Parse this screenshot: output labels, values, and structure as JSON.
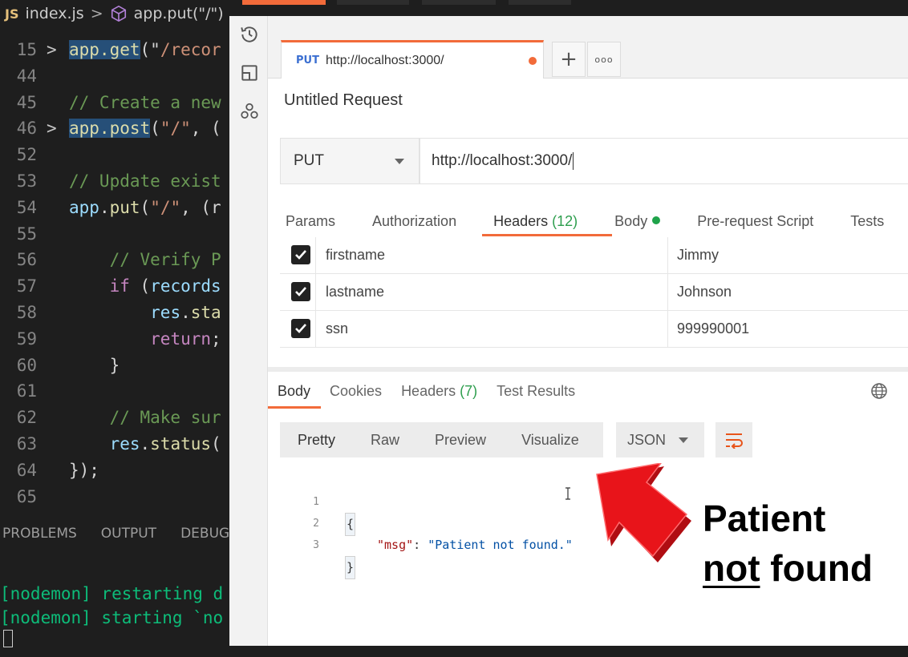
{
  "editor": {
    "breadcrumb": {
      "lang_badge": "JS",
      "file": "index.js",
      "sep": ">",
      "symbol": "app.put(\"/\")"
    },
    "lines": [
      {
        "n": "15",
        "fold": ">",
        "segments": [
          [
            "fn",
            "app.get"
          ],
          [
            "punc",
            "(\""
          ],
          [
            "str",
            "/recor"
          ]
        ]
      },
      {
        "n": "44",
        "fold": "",
        "segments": []
      },
      {
        "n": "45",
        "fold": "",
        "segments": [
          [
            "com",
            "// Create a new"
          ]
        ]
      },
      {
        "n": "46",
        "fold": ">",
        "segments": [
          [
            "fn",
            "app.post"
          ],
          [
            "punc",
            "("
          ],
          [
            "str",
            "\"/\""
          ],
          [
            "punc",
            ", ("
          ]
        ]
      },
      {
        "n": "52",
        "fold": "",
        "segments": []
      },
      {
        "n": "53",
        "fold": "",
        "segments": [
          [
            "com",
            "// Update exist"
          ]
        ]
      },
      {
        "n": "54",
        "fold": "",
        "segments": [
          [
            "obj",
            "app"
          ],
          [
            "punc",
            "."
          ],
          [
            "fnp",
            "put"
          ],
          [
            "punc",
            "("
          ],
          [
            "str",
            "\"/\""
          ],
          [
            "punc",
            ", (r"
          ]
        ]
      },
      {
        "n": "55",
        "fold": "",
        "segments": []
      },
      {
        "n": "56",
        "fold": "",
        "segments": [
          [
            "sp",
            "    "
          ],
          [
            "com",
            "// Verify P"
          ]
        ]
      },
      {
        "n": "57",
        "fold": "",
        "segments": [
          [
            "sp",
            "    "
          ],
          [
            "kw",
            "if"
          ],
          [
            "punc",
            " ("
          ],
          [
            "obj",
            "records"
          ]
        ]
      },
      {
        "n": "58",
        "fold": "",
        "segments": [
          [
            "sp",
            "        "
          ],
          [
            "obj",
            "res"
          ],
          [
            "punc",
            "."
          ],
          [
            "fnp",
            "sta"
          ]
        ]
      },
      {
        "n": "59",
        "fold": "",
        "segments": [
          [
            "sp",
            "        "
          ],
          [
            "kw",
            "return"
          ],
          [
            "punc",
            ";"
          ]
        ]
      },
      {
        "n": "60",
        "fold": "",
        "segments": [
          [
            "sp",
            "    "
          ],
          [
            "punc",
            "}"
          ]
        ]
      },
      {
        "n": "61",
        "fold": "",
        "segments": []
      },
      {
        "n": "62",
        "fold": "",
        "segments": [
          [
            "sp",
            "    "
          ],
          [
            "com",
            "// Make sur"
          ]
        ]
      },
      {
        "n": "63",
        "fold": "",
        "segments": [
          [
            "sp",
            "    "
          ],
          [
            "obj",
            "res"
          ],
          [
            "punc",
            "."
          ],
          [
            "fnp",
            "status"
          ],
          [
            "punc",
            "("
          ]
        ]
      },
      {
        "n": "64",
        "fold": "",
        "segments": [
          [
            "punc",
            "});"
          ]
        ]
      },
      {
        "n": "65",
        "fold": "",
        "segments": []
      }
    ],
    "panel_tabs": [
      "PROBLEMS",
      "OUTPUT",
      "DEBUG"
    ],
    "terminal": [
      "[nodemon] restarting d",
      "[nodemon] starting `no"
    ]
  },
  "postman": {
    "tab": {
      "method": "PUT",
      "url": "http://localhost:3000/"
    },
    "new_tab_label": "+",
    "more_label": "ooo",
    "request_title": "Untitled Request",
    "method": "PUT",
    "url": "http://localhost:3000/",
    "request_tabs": {
      "params": "Params",
      "authorization": "Authorization",
      "headers": "Headers",
      "headers_count": "(12)",
      "body": "Body",
      "prerequest": "Pre-request Script",
      "tests": "Tests"
    },
    "headers": [
      {
        "key": "firstname",
        "value": "Jimmy",
        "checked": true
      },
      {
        "key": "lastname",
        "value": "Johnson",
        "checked": true
      },
      {
        "key": "ssn",
        "value": "999990001",
        "checked": true
      }
    ],
    "response_tabs": {
      "body": "Body",
      "cookies": "Cookies",
      "headers": "Headers",
      "headers_count": "(7)",
      "test_results": "Test Results"
    },
    "view_modes": {
      "pretty": "Pretty",
      "raw": "Raw",
      "preview": "Preview",
      "visualize": "Visualize"
    },
    "format": "JSON",
    "json_lines": [
      {
        "n": "1",
        "text": "{"
      },
      {
        "n": "2",
        "key": "\"msg\"",
        "colon": ": ",
        "value": "\"Patient not found.\""
      },
      {
        "n": "3",
        "text": "}"
      }
    ]
  },
  "annotation": {
    "line1": "Patient",
    "line2_underlined": "not",
    "line2_rest": " found"
  },
  "colors": {
    "accent": "#f26b3a",
    "arrow": "#e8141a",
    "green": "#1fa34a"
  }
}
